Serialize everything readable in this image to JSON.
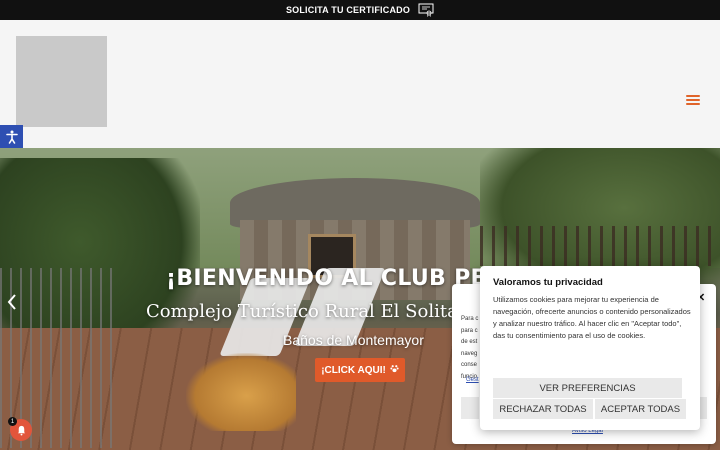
{
  "topbar": {
    "label": "SOLICITA TU CERTIFICADO",
    "icon": "certificate-icon"
  },
  "header": {
    "logo": "logo-placeholder",
    "menu_icon": "hamburger-menu-icon",
    "accessibility_icon": "accessibility-icon"
  },
  "hero": {
    "title": "¡BIENVENIDO AL CLUB PETS",
    "subtitle": "Complejo Turístico Rural El Solitario",
    "location": "Baños de Montemayor",
    "cta_label": "¡CLICK AQUI!",
    "cta_icon": "paw-icon",
    "prev_icon": "chevron-left-icon"
  },
  "notification": {
    "count": "1",
    "icon": "bell-icon"
  },
  "cookie_back": {
    "lines": [
      "Para c",
      "para c",
      "de est",
      "naveg",
      "conse",
      "funcio"
    ],
    "manage_link": "Gest",
    "legal_link": "Aviso Legal",
    "right_lines": [
      "s",
      "e",
      "e"
    ]
  },
  "cookie": {
    "title": "Valoramos tu privacidad",
    "body": "Utilizamos cookies para mejorar tu experiencia de navegación, ofrecerte anuncios o contenido personalizados y analizar nuestro tráfico. Al hacer clic en \"Aceptar todo\", das tu consentimiento para el uso de cookies.",
    "preferences": "VER PREFERENCIAS",
    "reject": "RECHAZAR TODAS",
    "accept": "ACEPTAR TODAS"
  },
  "colors": {
    "accent": "#e05a2a",
    "accessibility": "#2e4fb2",
    "topbar": "#111111"
  }
}
